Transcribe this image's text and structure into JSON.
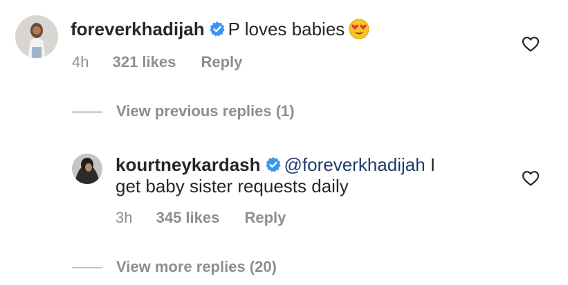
{
  "comments": [
    {
      "username": "foreverkhadijah",
      "text": "P loves babies",
      "emoji": "heart-eyes-emoji",
      "time": "4h",
      "likes": "321 likes",
      "reply": "Reply",
      "verified": true
    }
  ],
  "thread": {
    "view_previous": "View previous replies (1)",
    "view_more": "View more replies (20)"
  },
  "reply": {
    "username": "kourtneykardash",
    "mention": "@foreverkhadijah",
    "text_line1_suffix": " I",
    "text_line2": "get baby sister requests daily",
    "time": "3h",
    "likes": "345 likes",
    "reply": "Reply",
    "verified": true
  },
  "colors": {
    "text": "#262626",
    "muted": "#8e8e8e",
    "verified": "#3897f0",
    "mention": "#1f3b6f"
  },
  "icons": [
    "verified-badge-icon",
    "heart-outline-icon",
    "heart-eyes-emoji"
  ]
}
